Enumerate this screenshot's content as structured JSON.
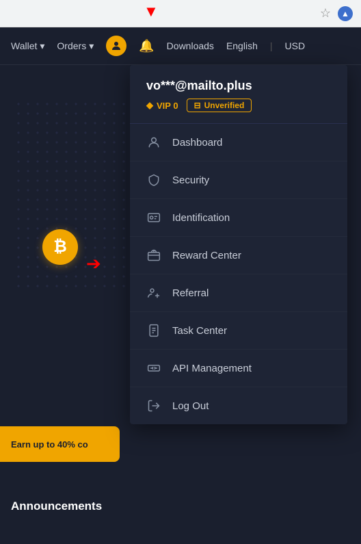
{
  "browser": {
    "star_icon": "☆",
    "brand_letter": "▲"
  },
  "navbar": {
    "wallet_label": "Wallet",
    "orders_label": "Orders",
    "downloads_label": "Downloads",
    "english_label": "English",
    "usd_label": "USD",
    "user_icon": "👤",
    "bell_icon": "🔔"
  },
  "dropdown": {
    "email": "vo***@mailto.plus",
    "vip_label": "VIP 0",
    "unverified_label": "Unverified",
    "items": [
      {
        "id": "dashboard",
        "label": "Dashboard",
        "icon": "dashboard"
      },
      {
        "id": "security",
        "label": "Security",
        "icon": "security"
      },
      {
        "id": "identification",
        "label": "Identification",
        "icon": "identification"
      },
      {
        "id": "reward-center",
        "label": "Reward Center",
        "icon": "reward"
      },
      {
        "id": "referral",
        "label": "Referral",
        "icon": "referral"
      },
      {
        "id": "task-center",
        "label": "Task Center",
        "icon": "task"
      },
      {
        "id": "api-management",
        "label": "API Management",
        "icon": "api"
      },
      {
        "id": "log-out",
        "label": "Log Out",
        "icon": "logout"
      }
    ]
  },
  "page": {
    "earn_text": "Earn up to 40% co",
    "announcements_title": "Announcements"
  }
}
